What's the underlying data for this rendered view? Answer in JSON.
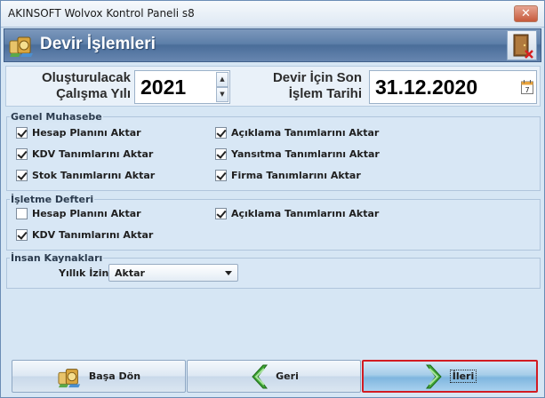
{
  "window": {
    "title": "AKINSOFT Wolvox Kontrol Paneli s8",
    "close_label": "✕"
  },
  "header": {
    "title": "Devir İşlemleri",
    "logo_icon": "money-bag-icon",
    "exit_icon": "exit-door-icon"
  },
  "top": {
    "year_label_line1": "Oluşturulacak",
    "year_label_line2": "Çalışma Yılı",
    "year_value": "2021",
    "date_label_line1": "Devir İçin Son",
    "date_label_line2": "İşlem Tarihi",
    "date_value": "31.12.2020",
    "calendar_day": "7"
  },
  "groups": {
    "genel_muhasebe": {
      "title": "Genel Muhasebe",
      "items": [
        {
          "label": "Hesap Planını Aktar",
          "checked": true
        },
        {
          "label": "Açıklama Tanımlarını Aktar",
          "checked": true
        },
        {
          "label": "KDV Tanımlarını Aktar",
          "checked": true
        },
        {
          "label": "Yansıtma Tanımlarını Aktar",
          "checked": true
        },
        {
          "label": "Stok Tanımlarını Aktar",
          "checked": true
        },
        {
          "label": "Firma Tanımlarını Aktar",
          "checked": true
        }
      ]
    },
    "isletme_defteri": {
      "title": "İşletme Defteri",
      "items": [
        {
          "label": "Hesap Planını Aktar",
          "checked": false
        },
        {
          "label": "Açıklama Tanımlarını Aktar",
          "checked": true
        },
        {
          "label": "KDV Tanımlarını Aktar",
          "checked": true
        }
      ]
    },
    "insan_kaynaklari": {
      "title": "İnsan Kaynakları",
      "izin_label": "Yıllık İzin",
      "izin_value": "Aktar"
    }
  },
  "buttons": {
    "basa_don": "Başa Dön",
    "geri": "Geri",
    "ileri": "İleri"
  },
  "colors": {
    "header_bg": "#5d7fa9",
    "focus_border": "#d21b22",
    "arrow_green": "#3fa535"
  }
}
